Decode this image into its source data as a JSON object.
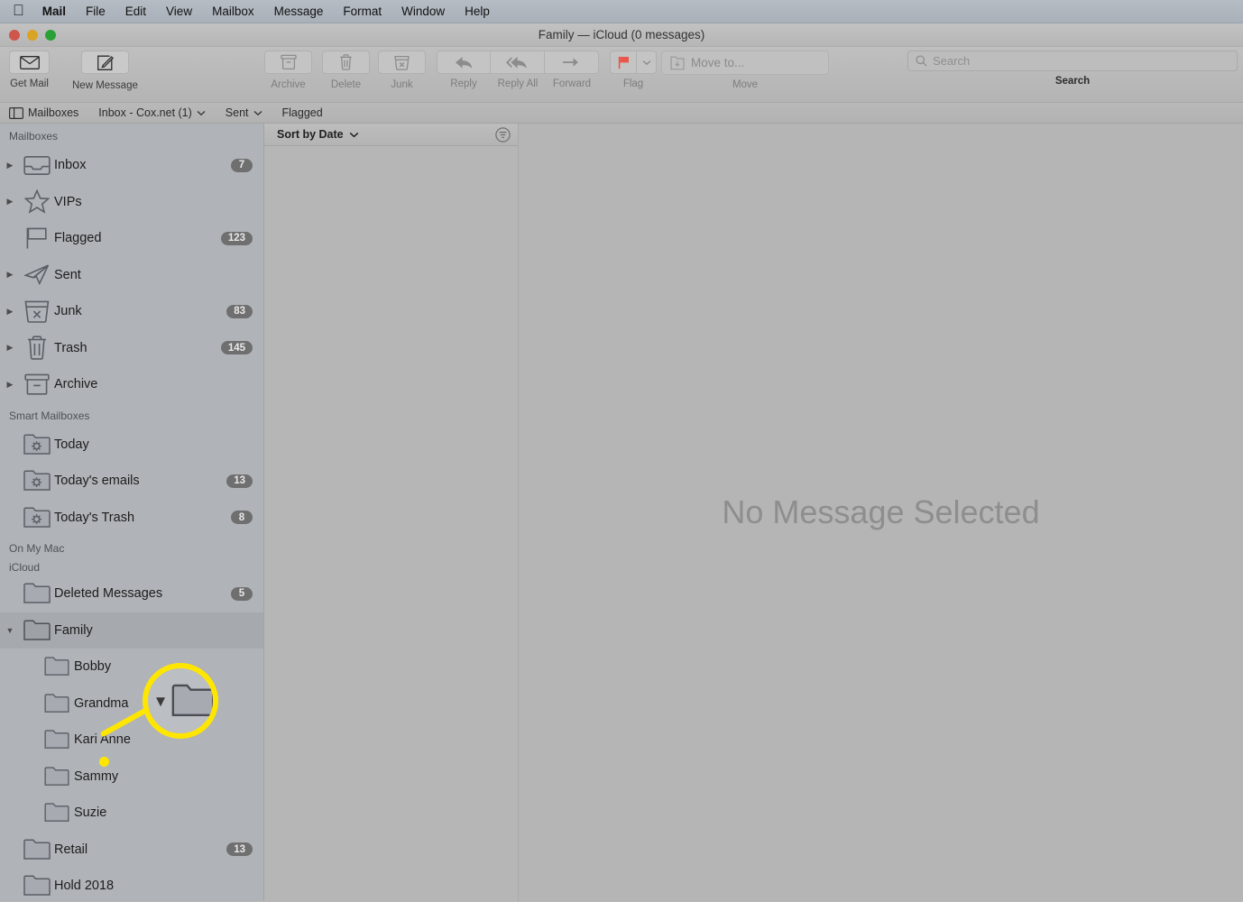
{
  "menubar": {
    "apple_icon": "apple-icon",
    "items": [
      {
        "label": "Mail",
        "bold": true
      },
      {
        "label": "File",
        "bold": false
      },
      {
        "label": "Edit",
        "bold": false
      },
      {
        "label": "View",
        "bold": false
      },
      {
        "label": "Mailbox",
        "bold": false
      },
      {
        "label": "Message",
        "bold": false
      },
      {
        "label": "Format",
        "bold": false
      },
      {
        "label": "Window",
        "bold": false
      },
      {
        "label": "Help",
        "bold": false
      }
    ]
  },
  "window": {
    "title": "Family — iCloud (0 messages)",
    "traffic_lights": [
      "close-button",
      "minimize-button",
      "zoom-button"
    ]
  },
  "toolbar": {
    "get_mail_label": "Get Mail",
    "new_message_label": "New Message",
    "archive_label": "Archive",
    "delete_label": "Delete",
    "junk_label": "Junk",
    "reply_label": "Reply",
    "reply_all_label": "Reply All",
    "forward_label": "Forward",
    "flag_label": "Flag",
    "move_label": "Move",
    "move_to_placeholder": "Move to...",
    "search_label": "Search",
    "search_placeholder": "Search",
    "search_value": "",
    "flag_color": "#e8564d"
  },
  "favorites_bar": {
    "items": [
      {
        "label": "Mailboxes",
        "icon": "sidebar-toggle-icon",
        "chevron": false
      },
      {
        "label": "Inbox - Cox.net (1)",
        "icon": "",
        "chevron": true
      },
      {
        "label": "Sent",
        "icon": "",
        "chevron": true
      },
      {
        "label": "Flagged",
        "icon": "",
        "chevron": false
      }
    ]
  },
  "sidebar": {
    "sections": [
      {
        "title": "Mailboxes",
        "items": [
          {
            "label": "Inbox",
            "icon": "inbox-icon",
            "badge": "7",
            "triangle": true,
            "selected": false,
            "indent": 0
          },
          {
            "label": "VIPs",
            "icon": "star-icon",
            "badge": "",
            "triangle": true,
            "selected": false,
            "indent": 0
          },
          {
            "label": "Flagged",
            "icon": "flag-icon",
            "badge": "123",
            "triangle": false,
            "selected": false,
            "indent": 0
          },
          {
            "label": "Sent",
            "icon": "sent-icon",
            "badge": "",
            "triangle": true,
            "selected": false,
            "indent": 0
          },
          {
            "label": "Junk",
            "icon": "junk-icon",
            "badge": "83",
            "triangle": true,
            "selected": false,
            "indent": 0
          },
          {
            "label": "Trash",
            "icon": "trash-icon",
            "badge": "145",
            "triangle": true,
            "selected": false,
            "indent": 0
          },
          {
            "label": "Archive",
            "icon": "archive-icon",
            "badge": "",
            "triangle": true,
            "selected": false,
            "indent": 0
          }
        ]
      },
      {
        "title": "Smart Mailboxes",
        "items": [
          {
            "label": "Today",
            "icon": "smart-folder-icon",
            "badge": "",
            "triangle": false,
            "selected": false,
            "indent": 0
          },
          {
            "label": "Today's emails",
            "icon": "smart-folder-icon",
            "badge": "13",
            "triangle": false,
            "selected": false,
            "indent": 0
          },
          {
            "label": "Today's Trash",
            "icon": "smart-folder-icon",
            "badge": "8",
            "triangle": false,
            "selected": false,
            "indent": 0
          }
        ]
      },
      {
        "title": "On My Mac",
        "items": []
      },
      {
        "title": "iCloud",
        "items": [
          {
            "label": "Deleted Messages",
            "icon": "folder-icon",
            "badge": "5",
            "triangle": false,
            "selected": false,
            "indent": 0
          },
          {
            "label": "Family",
            "icon": "folder-icon",
            "badge": "",
            "triangle": true,
            "selected": true,
            "indent": 0
          },
          {
            "label": "Bobby",
            "icon": "folder-icon",
            "badge": "",
            "triangle": false,
            "selected": false,
            "indent": 1
          },
          {
            "label": "Grandma",
            "icon": "folder-icon",
            "badge": "",
            "triangle": false,
            "selected": false,
            "indent": 1
          },
          {
            "label": "Kari Anne",
            "icon": "folder-icon",
            "badge": "",
            "triangle": false,
            "selected": false,
            "indent": 1
          },
          {
            "label": "Sammy",
            "icon": "folder-icon",
            "badge": "",
            "triangle": false,
            "selected": false,
            "indent": 1
          },
          {
            "label": "Suzie",
            "icon": "folder-icon",
            "badge": "",
            "triangle": false,
            "selected": false,
            "indent": 1
          },
          {
            "label": "Retail",
            "icon": "folder-icon",
            "badge": "13",
            "triangle": false,
            "selected": false,
            "indent": 0
          },
          {
            "label": "Hold 2018",
            "icon": "folder-icon",
            "badge": "",
            "triangle": false,
            "selected": false,
            "indent": 0
          }
        ]
      }
    ]
  },
  "message_list": {
    "sort_label": "Sort by Date",
    "filter_icon": "filter-icon",
    "messages": []
  },
  "message_view": {
    "empty_text": "No Message Selected"
  },
  "annotation": {
    "callout_icon": "folder-icon-magnified",
    "callout_triangle": "disclosure-triangle-down",
    "highlight_color": "#ffe600"
  }
}
